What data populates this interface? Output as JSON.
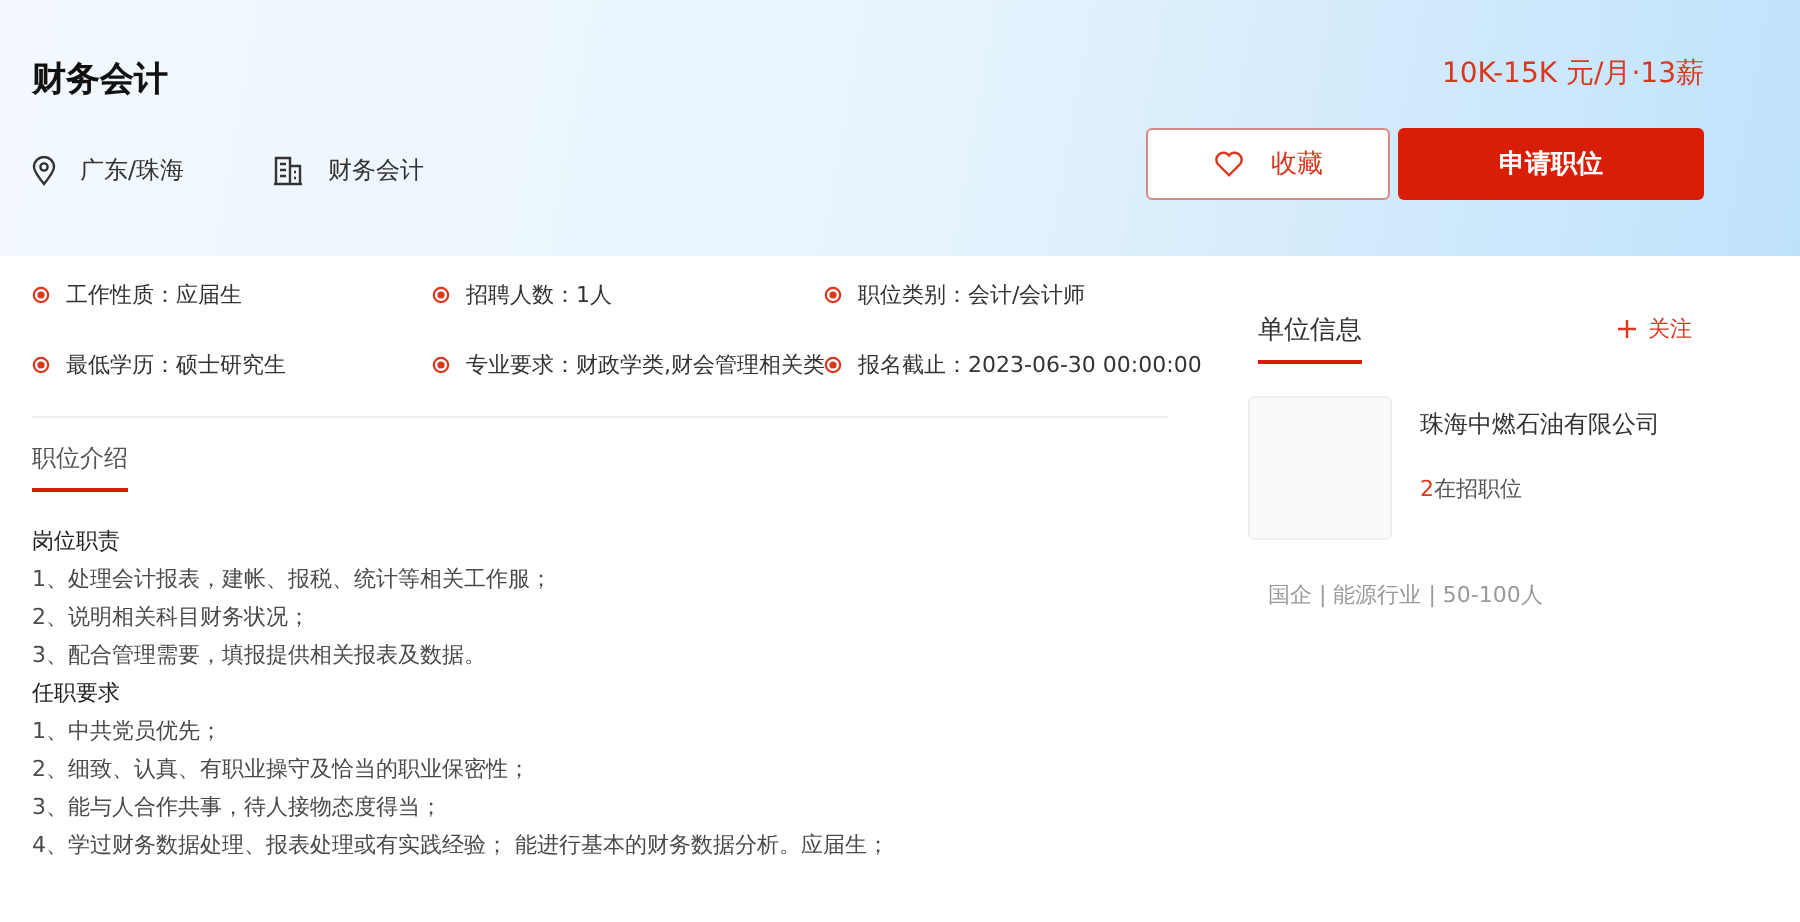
{
  "header": {
    "title": "财务会计",
    "salary": "10K-15K 元/月·13薪",
    "location": "广东/珠海",
    "category": "财务会计",
    "buttons": [
      {
        "kind": "outline",
        "label": "收藏"
      },
      {
        "kind": "primary",
        "label": "申请职位"
      }
    ]
  },
  "facts": [
    {
      "label": "工作性质：",
      "value": "应届生"
    },
    {
      "label": "招聘人数：",
      "value": "1人"
    },
    {
      "label": "职位类别：",
      "value": "会计/会计师"
    },
    {
      "label": "最低学历：",
      "value": "硕士研究生"
    },
    {
      "label": "专业要求：",
      "value": "财政学类,财会管理相关类"
    },
    {
      "label": "报名截止：",
      "value": "2023-06-30 00:00:00"
    }
  ],
  "description": {
    "heading": "职位介绍",
    "lines": [
      {
        "kind": "heading",
        "text": "岗位职责"
      },
      {
        "kind": "item",
        "text": "1、处理会计报表，建帐、报税、统计等相关工作服；"
      },
      {
        "kind": "item",
        "text": "2、说明相关科目财务状况；"
      },
      {
        "kind": "item",
        "text": "3、配合管理需要，填报提供相关报表及数据。"
      },
      {
        "kind": "heading",
        "text": "任职要求"
      },
      {
        "kind": "item",
        "text": "1、中共党员优先；"
      },
      {
        "kind": "item",
        "text": "2、细致、认真、有职业操守及恰当的职业保密性；"
      },
      {
        "kind": "item",
        "text": "3、能与人合作共事，待人接物态度得当；"
      },
      {
        "kind": "item",
        "text": "4、学过财务数据处理、报表处理或有实践经验； 能进行基本的财务数据分析。应届生；"
      }
    ]
  },
  "company": {
    "heading": "单位信息",
    "follow": "关注",
    "name": "珠海中燃石油有限公司",
    "openings_count": "2",
    "openings_label": "在招职位",
    "tags": "国企 | 能源行业 | 50-100人"
  }
}
